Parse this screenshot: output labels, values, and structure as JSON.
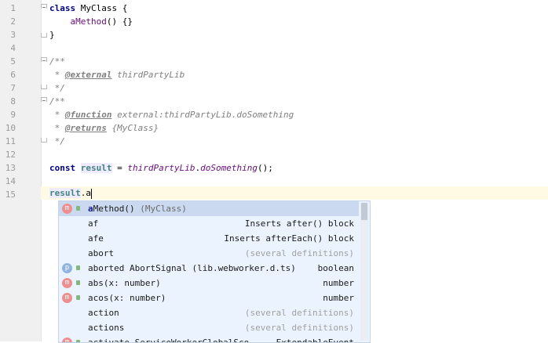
{
  "editor": {
    "line_numbers": [
      "1",
      "2",
      "3",
      "4",
      "5",
      "6",
      "7",
      "8",
      "9",
      "10",
      "11",
      "12",
      "13",
      "14",
      "15"
    ],
    "code": {
      "l1_kw": "class",
      "l1_rest": " MyClass {",
      "l2_fn": "aMethod",
      "l2_rest": "() {}",
      "l3": "}",
      "l5": "/**",
      "l6_star": " * ",
      "l6_tag": "@external",
      "l6_rest": " thirdPartyLib",
      "l7": " */",
      "l8": "/**",
      "l9_star": " * ",
      "l9_tag": "@function",
      "l9_rest": " external:thirdPartyLib.doSomething",
      "l10_star": " * ",
      "l10_tag": "@returns",
      "l10_rest": " {MyClass}",
      "l11": " */",
      "l13_kw": "const",
      "l13_sp": " ",
      "l13_var": "result",
      "l13_eq": " = ",
      "l13_lib": "thirdPartyLib",
      "l13_dot": ".",
      "l13_fn": "doSomething",
      "l13_end": "();",
      "l15_var": "result",
      "l15_dot": ".",
      "l15_typed": "a"
    }
  },
  "completion": {
    "items": [
      {
        "icon": "m",
        "prefix": "a",
        "name": "Method()",
        "tail": "(MyClass)",
        "selected": true
      },
      {
        "icon": "",
        "prefix": "",
        "name": "af",
        "tail": "Inserts after() block"
      },
      {
        "icon": "",
        "prefix": "",
        "name": "afe",
        "tail": "Inserts afterEach() block"
      },
      {
        "icon": "",
        "prefix": "",
        "name": "abort",
        "tail": "(several definitions)",
        "grey": true
      },
      {
        "icon": "p",
        "prefix": "",
        "name": "aborted AbortSignal (lib.webworker.d.ts)",
        "tail": "boolean"
      },
      {
        "icon": "m",
        "prefix": "",
        "name": "abs(x: number)",
        "tail": "number"
      },
      {
        "icon": "m",
        "prefix": "",
        "name": "acos(x: number)",
        "tail": "number"
      },
      {
        "icon": "",
        "prefix": "",
        "name": "action",
        "tail": "(several definitions)",
        "grey": true
      },
      {
        "icon": "",
        "prefix": "",
        "name": "actions",
        "tail": "(several definitions)",
        "grey": true
      },
      {
        "icon": "m",
        "prefix": "",
        "name": "activate ServiceWorkerGlobalSco...",
        "tail": "ExtendableEvent"
      }
    ]
  }
}
